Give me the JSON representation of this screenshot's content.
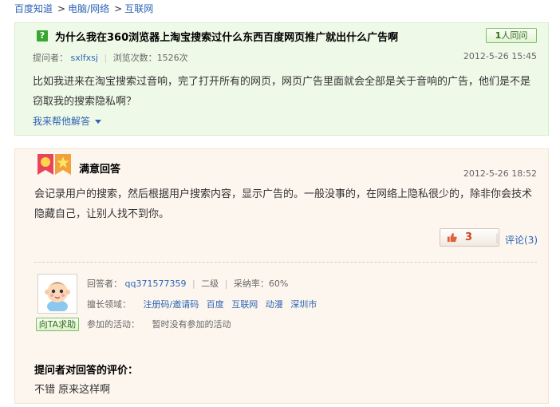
{
  "breadcrumb": {
    "items": [
      "百度知道",
      "电脑/网络",
      "互联网"
    ],
    "separator": ">"
  },
  "question": {
    "icon_glyph": "?",
    "title": "为什么我在360浏览器上淘宝搜索过什么东西百度网页推广就出什么广告啊",
    "same_button": {
      "count": "1",
      "suffix": "人同问"
    },
    "asker_label": "提问者：",
    "asker_name": "sxlfxsj",
    "views_label": "浏览次数：",
    "views_value": "1526次",
    "date": "2012-5-26 15:45",
    "body": "比如我进来在淘宝搜索过音响，完了打开所有的网页，网页广告里面就会全部是关于音响的广告，他们是不是窃取我的搜索隐私啊？",
    "help_link": "我来帮他解答"
  },
  "answer": {
    "title": "满意回答",
    "date": "2012-5-26 18:52",
    "body": "会记录用户的搜索，然后根据用户搜索内容，显示广告的。一般没事的，在网络上隐私很少的，除非你会技术隐藏自己，让别人找不到你。",
    "likes": "3",
    "comment_label": "评论",
    "comment_count": "(3)",
    "answerer": {
      "label": "回答者：",
      "name": "qq371577359",
      "level": "二级",
      "adopt_label": "采纳率：",
      "adopt_rate": "60%",
      "expertise_label": "擅长领域：",
      "expertise": [
        "注册码/邀请码",
        "百度",
        "互联网",
        "动漫",
        "深圳市"
      ],
      "activity_label": "参加的活动：",
      "activity_value": "暂时没有参加的活动",
      "ask_help_button": "向TA求助"
    },
    "evaluation": {
      "heading": "提问者对回答的评价：",
      "text": "不错  原来这样啊"
    }
  },
  "colors": {
    "link": "#2d64b3",
    "question_bg": "#eff9e8",
    "answer_bg": "#fdf6ef",
    "green_accent": "#3aa632",
    "like_red": "#d0451b"
  }
}
